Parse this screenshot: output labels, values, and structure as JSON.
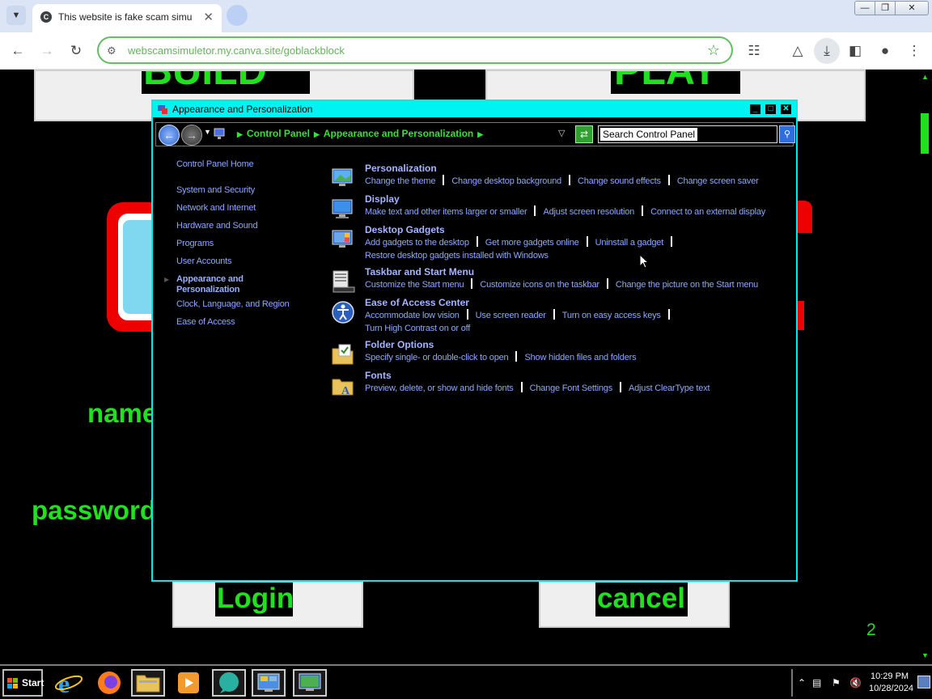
{
  "browser": {
    "tab_title": "This website is fake scam simu",
    "tab_favicon_letter": "C",
    "url": "webscamsimuletor.my.canva.site/goblackblock",
    "icons": [
      "tab-search-icon",
      "close-icon",
      "back-icon",
      "forward-icon",
      "reload-icon",
      "site-info-icon",
      "bookmark-star-icon",
      "extensions-icon",
      "labs-icon",
      "download-icon",
      "side-panel-icon",
      "profile-icon",
      "menu-icon"
    ]
  },
  "webpage": {
    "top_left_button_text": "BUILD",
    "top_right_button_text": "PLAY",
    "name_label": "name",
    "password_label": "password",
    "login_label": "Login",
    "cancel_label": "cancel",
    "counter": "2",
    "accent_color": "#20e020"
  },
  "dialog": {
    "title": "Appearance and Personalization",
    "breadcrumb": [
      "Control Panel",
      "Appearance and Personalization"
    ],
    "search_placeholder": "Search Control Panel",
    "sidebar": [
      {
        "label": "Control Panel Home"
      },
      {
        "label": "System and Security"
      },
      {
        "label": "Network and Internet"
      },
      {
        "label": "Hardware and Sound"
      },
      {
        "label": "Programs"
      },
      {
        "label": "User Accounts"
      },
      {
        "label": "Appearance and Personalization",
        "current": true
      },
      {
        "label": "Clock, Language, and Region"
      },
      {
        "label": "Ease of Access"
      }
    ],
    "categories": [
      {
        "title": "Personalization",
        "icon": "personalization-icon",
        "links": [
          "Change the theme",
          "Change desktop background",
          "Change sound effects",
          "Change screen saver"
        ]
      },
      {
        "title": "Display",
        "icon": "display-icon",
        "links": [
          "Make text and other items larger or smaller",
          "Adjust screen resolution",
          "Connect to an external display"
        ]
      },
      {
        "title": "Desktop Gadgets",
        "icon": "gadgets-icon",
        "links": [
          "Add gadgets to the desktop",
          "Get more gadgets online",
          "Uninstall a gadget"
        ],
        "links2": [
          "Restore desktop gadgets installed with Windows"
        ]
      },
      {
        "title": "Taskbar and Start Menu",
        "icon": "taskbar-icon",
        "links": [
          "Customize the Start menu",
          "Customize icons on the taskbar",
          "Change the picture on the Start menu"
        ]
      },
      {
        "title": "Ease of Access Center",
        "icon": "ease-of-access-icon",
        "links": [
          "Accommodate low vision",
          "Use screen reader",
          "Turn on easy access keys"
        ],
        "links2": [
          "Turn High Contrast on or off"
        ]
      },
      {
        "title": "Folder Options",
        "icon": "folder-options-icon",
        "links": [
          "Specify single- or double-click to open",
          "Show hidden files and folders"
        ]
      },
      {
        "title": "Fonts",
        "icon": "fonts-icon",
        "links": [
          "Preview, delete, or show and hide fonts",
          "Change Font Settings",
          "Adjust ClearType text"
        ]
      }
    ]
  },
  "taskbar": {
    "start_label": "Start",
    "apps": [
      "internet-explorer-icon",
      "firefox-icon",
      "file-explorer-icon",
      "media-player-icon",
      "chat-icon",
      "control-panel-icon",
      "computer-icon"
    ],
    "time": "10:29 PM",
    "date": "10/28/2024"
  }
}
